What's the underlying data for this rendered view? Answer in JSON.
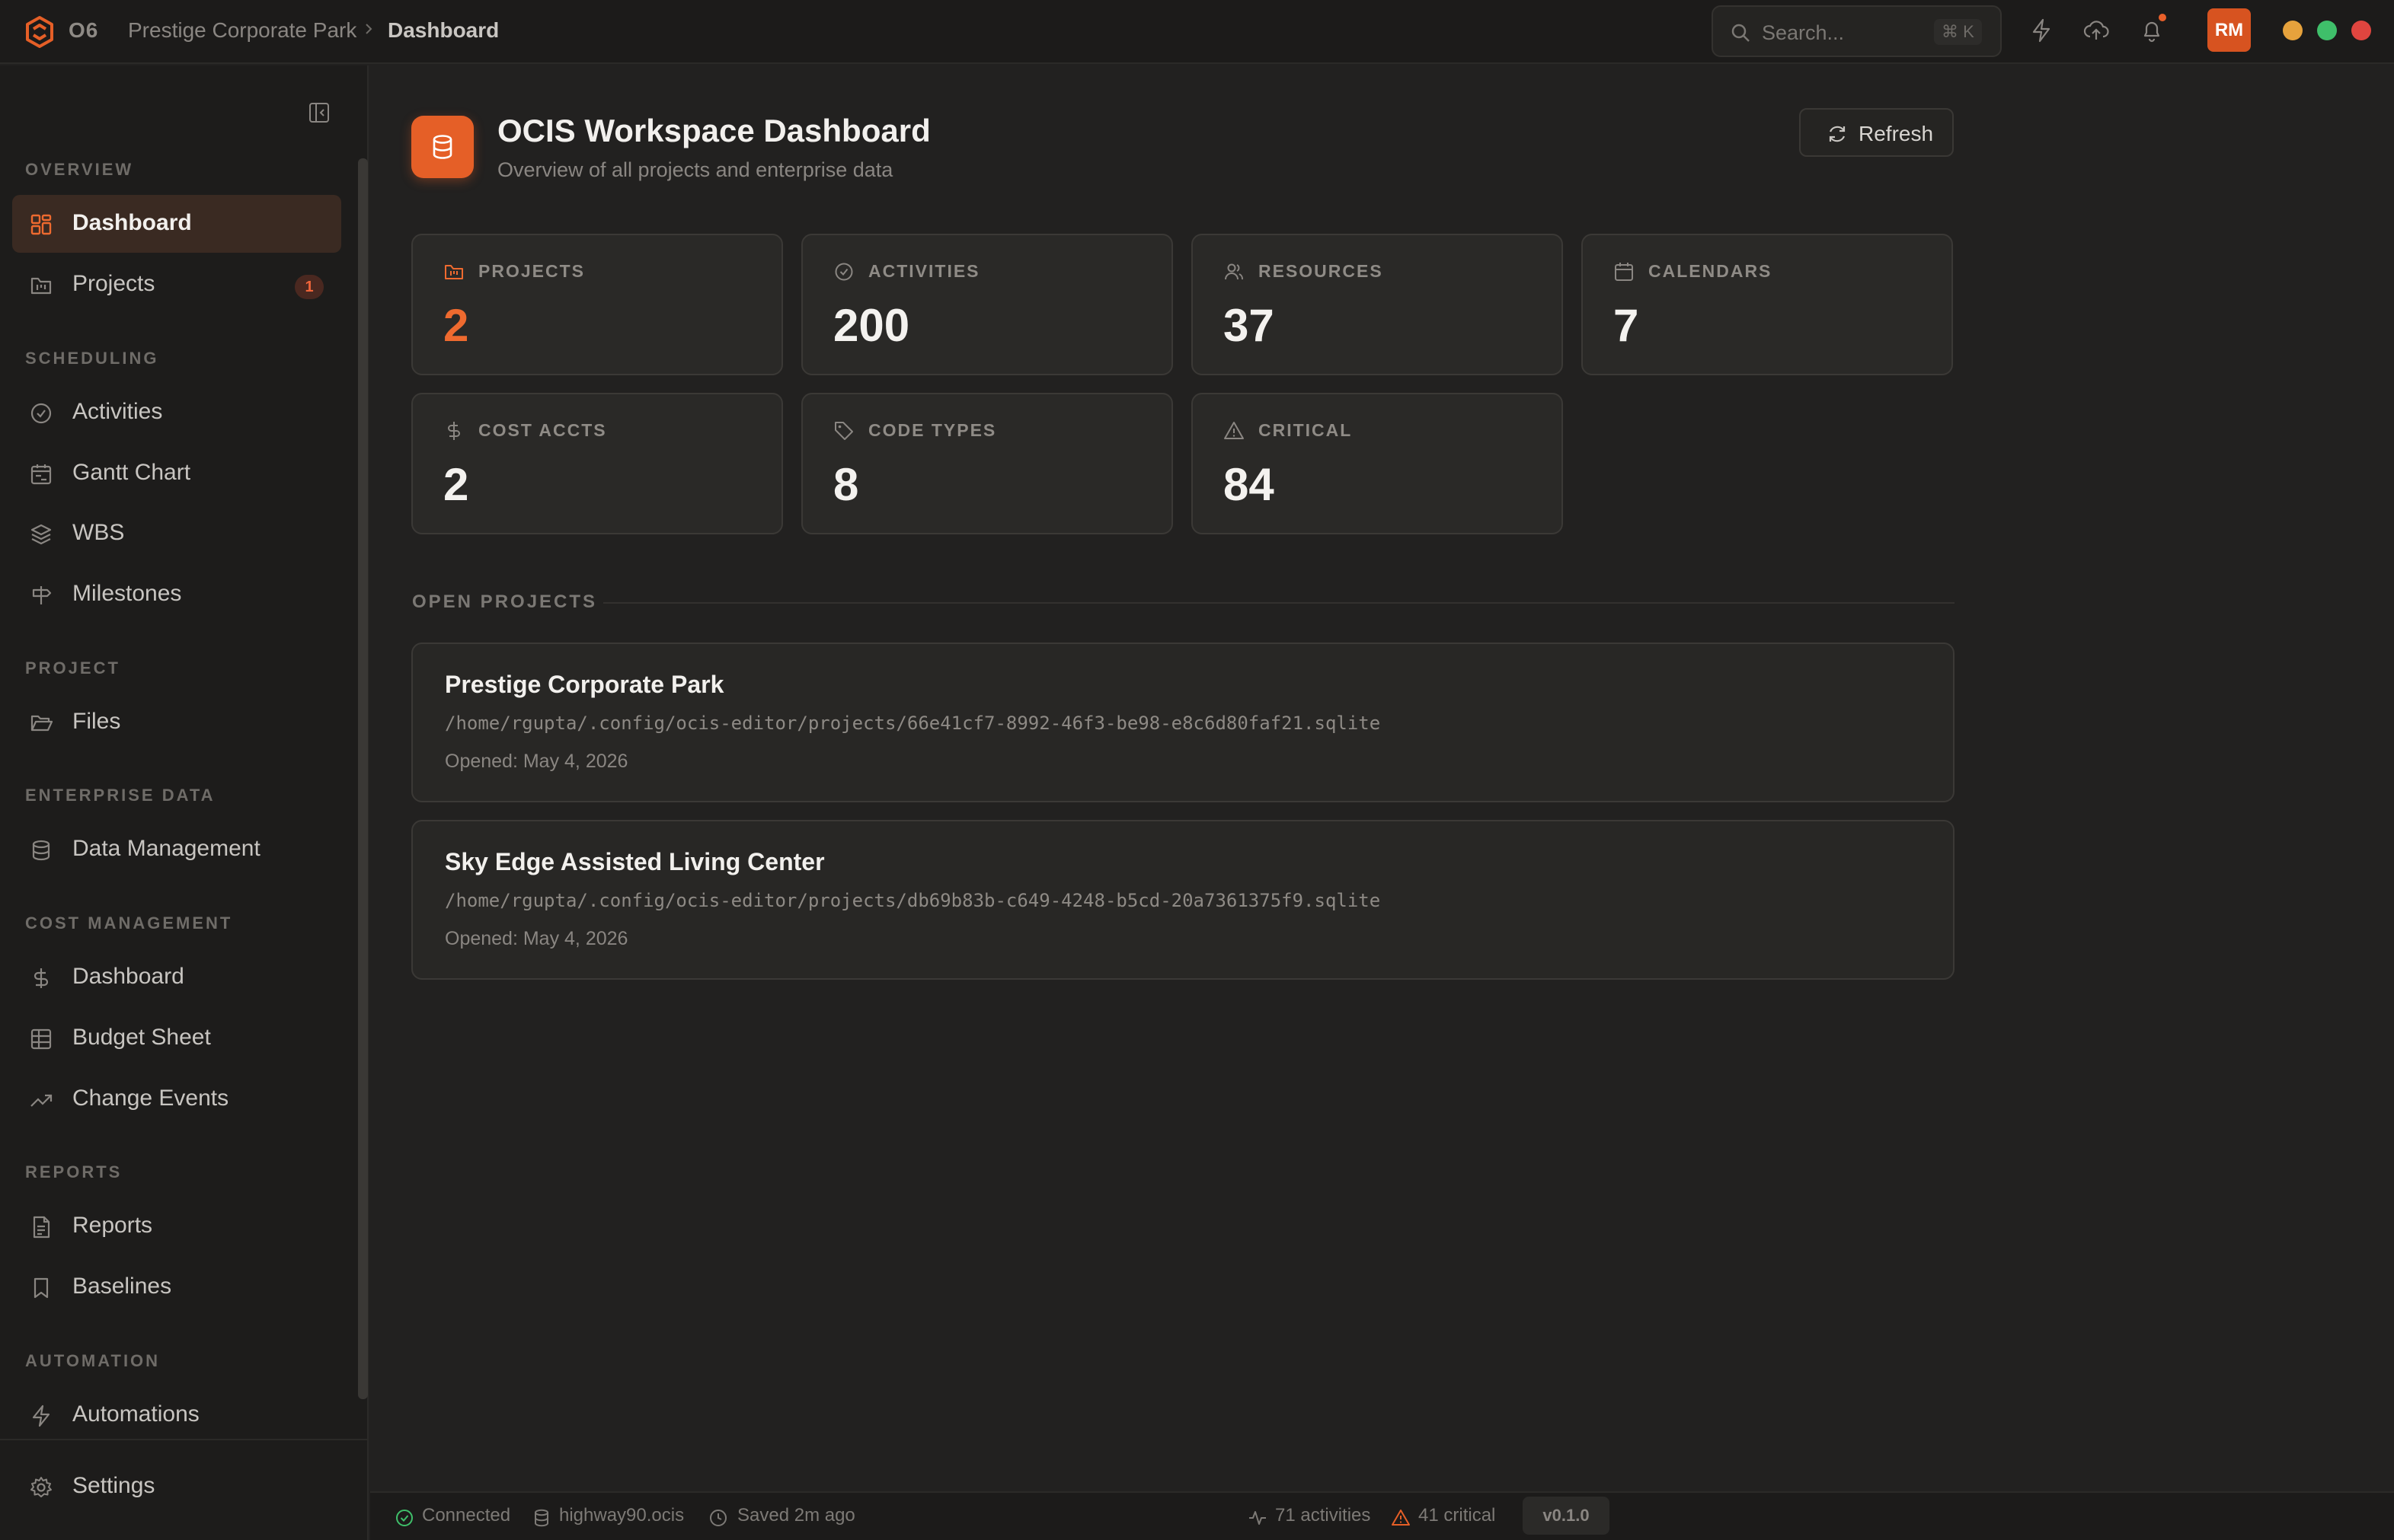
{
  "app": {
    "brand": "O6",
    "breadcrumb": [
      "Prestige Corporate Park",
      "Dashboard"
    ]
  },
  "topbar": {
    "search_placeholder": "Search...",
    "search_shortcut": "⌘ K",
    "avatar_initials": "RM",
    "icons": [
      "zap-icon",
      "cloud-upload-icon",
      "bell-icon"
    ],
    "window_controls": [
      "#e6a23c",
      "#3fbf6a",
      "#e0453f"
    ]
  },
  "sidebar": {
    "sections": [
      {
        "title": "OVERVIEW",
        "items": [
          {
            "label": "Dashboard",
            "icon": "layout-grid-icon",
            "active": true
          },
          {
            "label": "Projects",
            "icon": "folder-kanban-icon",
            "badge": "1"
          }
        ]
      },
      {
        "title": "SCHEDULING",
        "items": [
          {
            "label": "Activities",
            "icon": "check-circle-icon"
          },
          {
            "label": "Gantt Chart",
            "icon": "calendar-range-icon"
          },
          {
            "label": "WBS",
            "icon": "layers-icon"
          },
          {
            "label": "Milestones",
            "icon": "signpost-icon"
          }
        ]
      },
      {
        "title": "PROJECT",
        "items": [
          {
            "label": "Files",
            "icon": "folder-open-icon"
          }
        ]
      },
      {
        "title": "ENTERPRISE DATA",
        "items": [
          {
            "label": "Data Management",
            "icon": "database-icon"
          }
        ]
      },
      {
        "title": "COST MANAGEMENT",
        "items": [
          {
            "label": "Dashboard",
            "icon": "dollar-icon"
          },
          {
            "label": "Budget Sheet",
            "icon": "table-icon"
          },
          {
            "label": "Change Events",
            "icon": "trending-up-icon"
          }
        ]
      },
      {
        "title": "REPORTS",
        "items": [
          {
            "label": "Reports",
            "icon": "file-text-icon"
          },
          {
            "label": "Baselines",
            "icon": "bookmark-icon"
          }
        ]
      },
      {
        "title": "AUTOMATION",
        "items": [
          {
            "label": "Automations",
            "icon": "zap-icon"
          }
        ]
      }
    ],
    "settings_label": "Settings"
  },
  "header": {
    "title": "OCIS Workspace Dashboard",
    "subtitle": "Overview of all projects and enterprise data",
    "refresh_label": "Refresh"
  },
  "stats": [
    {
      "label": "PROJECTS",
      "value": "2",
      "icon": "folder-kanban-icon",
      "accent": "#ee6a2f"
    },
    {
      "label": "ACTIVITIES",
      "value": "200",
      "icon": "check-circle-icon"
    },
    {
      "label": "RESOURCES",
      "value": "37",
      "icon": "users-icon"
    },
    {
      "label": "CALENDARS",
      "value": "7",
      "icon": "calendar-icon"
    },
    {
      "label": "COST ACCTS",
      "value": "2",
      "icon": "dollar-icon"
    },
    {
      "label": "CODE TYPES",
      "value": "8",
      "icon": "tag-icon"
    },
    {
      "label": "CRITICAL",
      "value": "84",
      "icon": "alert-triangle-icon"
    }
  ],
  "open_projects": {
    "title": "OPEN PROJECTS",
    "items": [
      {
        "name": "Prestige Corporate Park",
        "path": "/home/rgupta/.config/ocis-editor/projects/66e41cf7-8992-46f3-be98-e8c6d80faf21.sqlite",
        "opened": "Opened: May 4, 2026"
      },
      {
        "name": "Sky Edge Assisted Living Center",
        "path": "/home/rgupta/.config/ocis-editor/projects/db69b83b-c649-4248-b5cd-20a7361375f9.sqlite",
        "opened": "Opened: May 4, 2026"
      }
    ]
  },
  "statusbar": {
    "connection": "Connected",
    "database": "highway90.ocis",
    "saved": "Saved 2m ago",
    "activities": "71 activities",
    "critical": "41 critical",
    "version": "v0.1.0"
  },
  "colors": {
    "accent": "#e55f27",
    "connected": "#3fbf6a",
    "warning": "#e55f27"
  }
}
